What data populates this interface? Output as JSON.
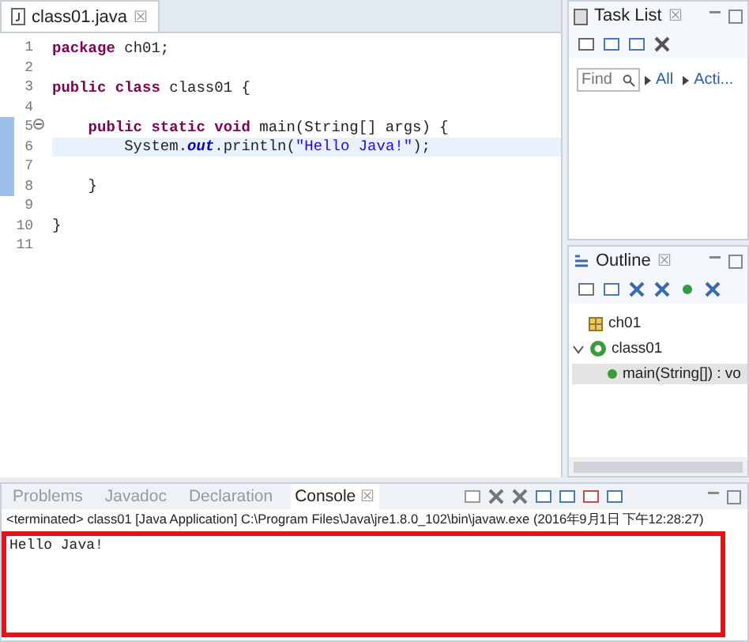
{
  "editor": {
    "tab": {
      "label": "class01.java",
      "close": "☒"
    },
    "lines": [
      {
        "number": "1",
        "in_range": false,
        "current": false,
        "foldable": false,
        "tokens": [
          {
            "text": "package",
            "kind": "keyword"
          },
          {
            "text": " ch01;",
            "kind": "plain"
          }
        ]
      },
      {
        "number": "2",
        "in_range": false,
        "current": false,
        "foldable": false
      },
      {
        "number": "3",
        "in_range": false,
        "current": false,
        "foldable": false,
        "tokens": [
          {
            "text": "public class",
            "kind": "keyword"
          },
          {
            "text": " class01 {",
            "kind": "plain"
          }
        ]
      },
      {
        "number": "4",
        "in_range": false,
        "current": false,
        "foldable": false
      },
      {
        "number": "5",
        "in_range": true,
        "current": false,
        "foldable": true,
        "tokens": [
          {
            "text": "    public static void",
            "kind": "keyword"
          },
          {
            "text": " main(String[] args) {",
            "kind": "plain"
          }
        ]
      },
      {
        "number": "6",
        "in_range": true,
        "current": true,
        "foldable": false,
        "tokens": [
          {
            "text": "        System.",
            "kind": "plain"
          },
          {
            "text": "out",
            "kind": "field"
          },
          {
            "text": ".println(",
            "kind": "plain"
          },
          {
            "text": "\"Hello Java!\"",
            "kind": "string"
          },
          {
            "text": ");",
            "kind": "plain"
          }
        ]
      },
      {
        "number": "7",
        "in_range": true,
        "current": false,
        "foldable": false
      },
      {
        "number": "8",
        "in_range": true,
        "current": false,
        "foldable": false,
        "tokens": [
          {
            "text": "    }",
            "kind": "plain"
          }
        ]
      },
      {
        "number": "9",
        "in_range": false,
        "current": false,
        "foldable": false
      },
      {
        "number": "10",
        "in_range": false,
        "current": false,
        "foldable": false,
        "tokens": [
          {
            "text": "}",
            "kind": "plain"
          }
        ]
      },
      {
        "number": "11",
        "in_range": false,
        "current": false,
        "foldable": false
      }
    ]
  },
  "task_list": {
    "title": "Task List",
    "close": "☒",
    "find": {
      "placeholder": "Find"
    },
    "links": [
      "All",
      "Acti..."
    ]
  },
  "outline": {
    "title": "Outline",
    "close": "☒",
    "tree": [
      {
        "label": "ch01",
        "kind": "package",
        "selected": false
      },
      {
        "label": "class01",
        "kind": "class",
        "selected": false,
        "expanded": true,
        "children": [
          {
            "label": "main(String[]) : vo",
            "kind": "method",
            "selected": true
          }
        ]
      }
    ]
  },
  "console": {
    "tabs": [
      {
        "label": "Problems",
        "selected": false
      },
      {
        "label": "Javadoc",
        "selected": false
      },
      {
        "label": "Declaration",
        "selected": false
      },
      {
        "label": "Console",
        "selected": true,
        "close": "☒"
      }
    ],
    "status": "<terminated> class01 [Java Application] C:\\Program Files\\Java\\jre1.8.0_102\\bin\\javaw.exe (2016年9月1日 下午12:28:27)",
    "output": [
      "Hello Java!"
    ],
    "highlighted": true
  }
}
